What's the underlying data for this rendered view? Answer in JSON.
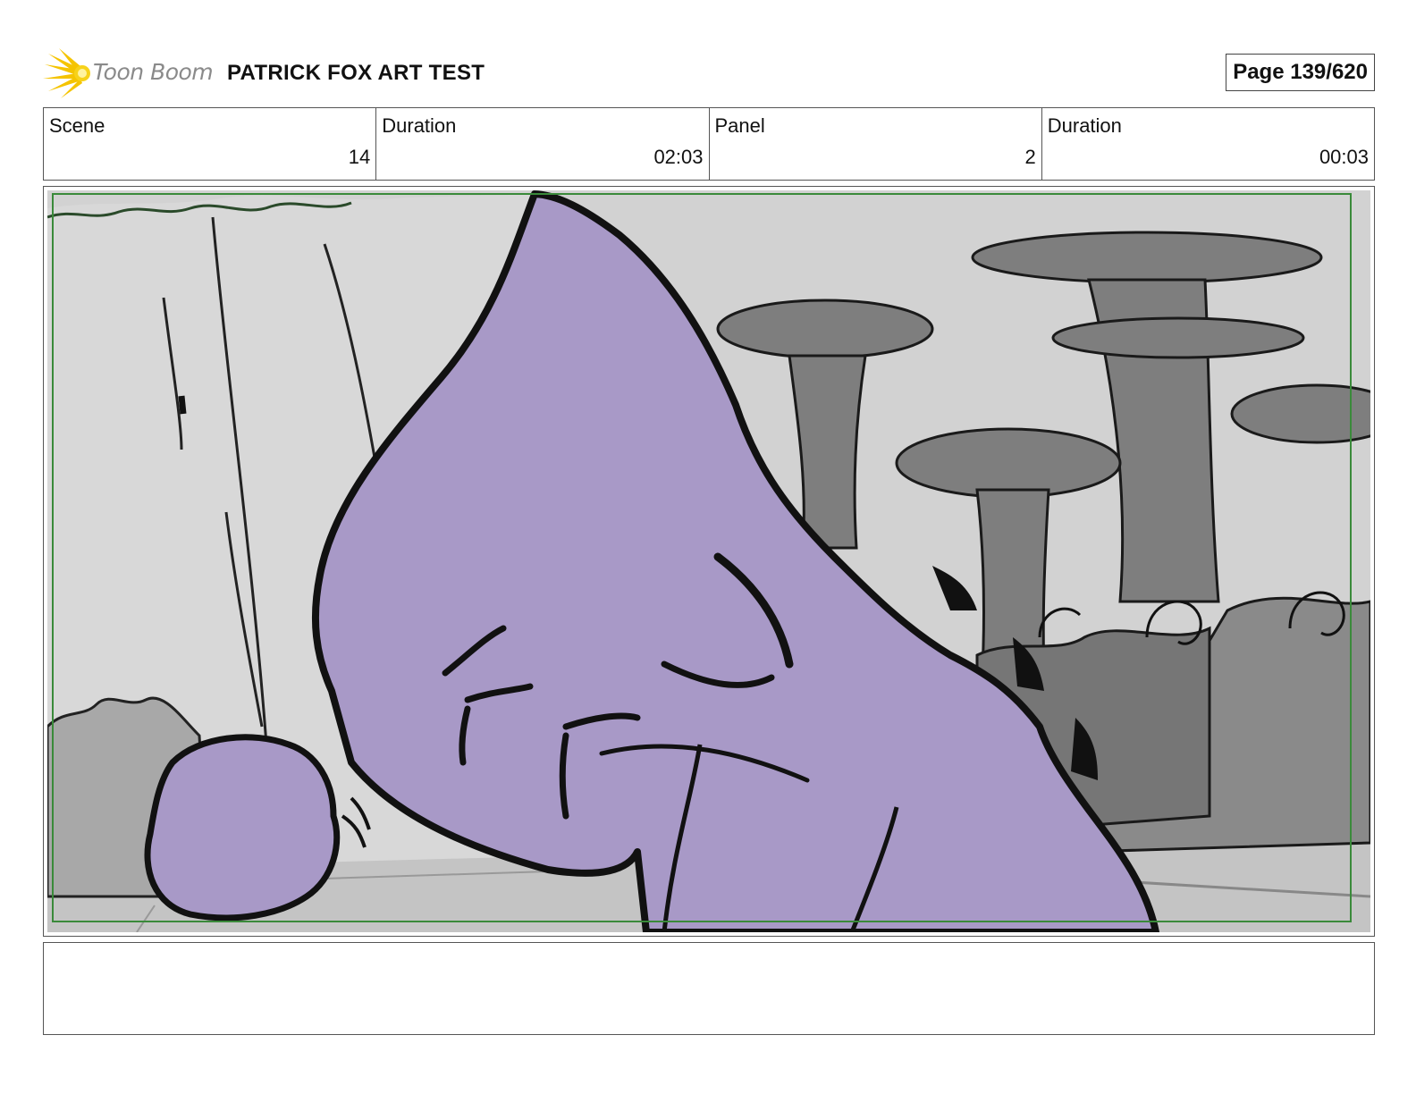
{
  "header": {
    "logo_text": "Toon Boom",
    "project_title": "PATRICK FOX ART TEST",
    "page_indicator": "Page 139/620"
  },
  "info": {
    "scene_label": "Scene",
    "scene_value": "14",
    "scene_duration_label": "Duration",
    "scene_duration_value": "02:03",
    "panel_label": "Panel",
    "panel_value": "2",
    "panel_duration_label": "Duration",
    "panel_duration_value": "00:03"
  },
  "notes": {
    "text": ""
  },
  "colors": {
    "character_fill": "#a899c7",
    "safe_frame": "#3a8a3a",
    "logo_accent": "#f5c400"
  }
}
